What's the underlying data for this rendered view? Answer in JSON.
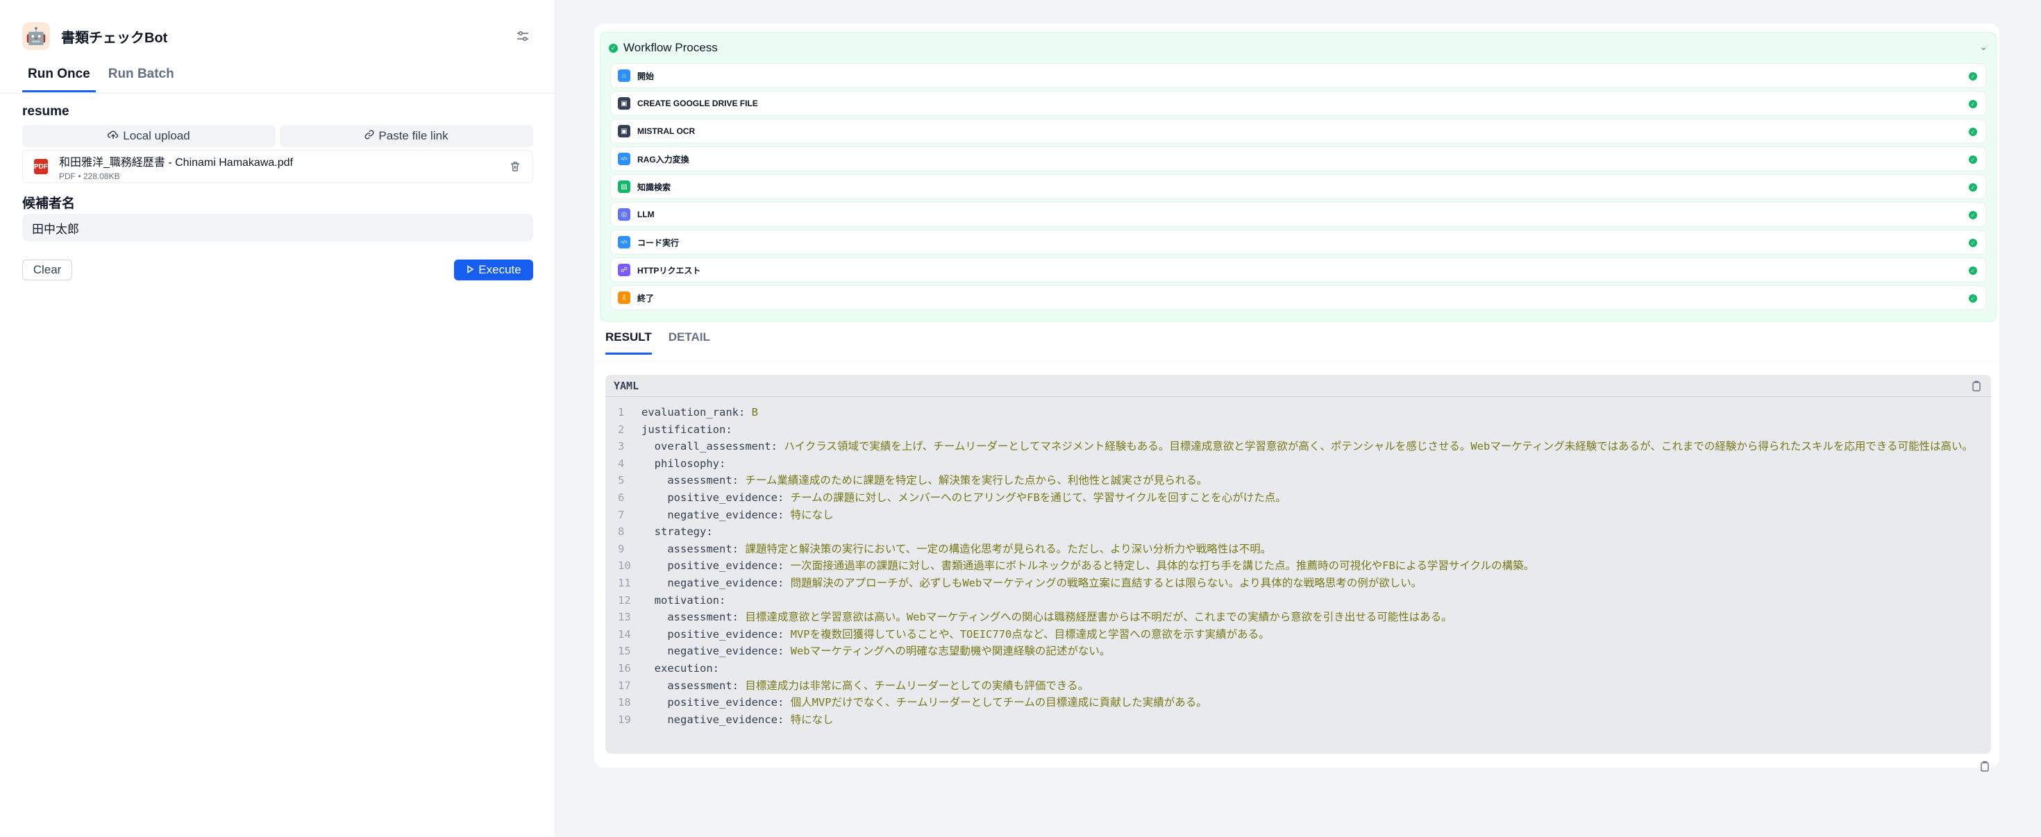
{
  "app": {
    "title": "書類チェックBot",
    "tabs": [
      "Run Once",
      "Run Batch"
    ]
  },
  "form": {
    "resume_label": "resume",
    "local_upload": "Local upload",
    "paste_link": "Paste file link",
    "file": {
      "name": "和田雅洋_職務経歴書 - Chinami Hamakawa.pdf",
      "meta": "PDF • 228.08KB",
      "type_badge": "PDF"
    },
    "candidate_label": "候補者名",
    "candidate_value": "田中太郎",
    "clear_label": "Clear",
    "execute_label": "Execute"
  },
  "workflow": {
    "title": "Workflow Process",
    "nodes": [
      {
        "label": "開始",
        "color": "#2e90fa"
      },
      {
        "label": "CREATE GOOGLE DRIVE FILE",
        "color": "#344054"
      },
      {
        "label": "MISTRAL OCR",
        "color": "#344054"
      },
      {
        "label": "RAG入力変換",
        "color": "#2e90fa"
      },
      {
        "label": "知識検索",
        "color": "#12b76a"
      },
      {
        "label": "LLM",
        "color": "#6172f3"
      },
      {
        "label": "コード実行",
        "color": "#2e90fa"
      },
      {
        "label": "HTTPリクエスト",
        "color": "#7a5af8"
      },
      {
        "label": "終了",
        "color": "#f79009"
      }
    ]
  },
  "result": {
    "tabs": [
      "RESULT",
      "DETAIL"
    ],
    "lang": "YAML",
    "lines": [
      {
        "n": "1",
        "indent": "",
        "key": "evaluation_rank:",
        "val": " B"
      },
      {
        "n": "2",
        "indent": "",
        "key": "justification:",
        "val": ""
      },
      {
        "n": "3",
        "indent": "  ",
        "key": "overall_assessment:",
        "val": " ハイクラス領域で実績を上げ、チームリーダーとしてマネジメント経験もある。目標達成意欲と学習意欲が高く、ポテンシャルを感じさせる。Webマーケティング未経験ではあるが、これまでの経験から得られたスキルを応用できる可能性は高い。"
      },
      {
        "n": "4",
        "indent": "  ",
        "key": "philosophy:",
        "val": ""
      },
      {
        "n": "5",
        "indent": "    ",
        "key": "assessment:",
        "val": " チーム業績達成のために課題を特定し、解決策を実行した点から、利他性と誠実さが見られる。"
      },
      {
        "n": "6",
        "indent": "    ",
        "key": "positive_evidence:",
        "val": " チームの課題に対し、メンバーへのヒアリングやFBを通じて、学習サイクルを回すことを心がけた点。"
      },
      {
        "n": "7",
        "indent": "    ",
        "key": "negative_evidence:",
        "val": " 特になし"
      },
      {
        "n": "8",
        "indent": "  ",
        "key": "strategy:",
        "val": ""
      },
      {
        "n": "9",
        "indent": "    ",
        "key": "assessment:",
        "val": " 課題特定と解決策の実行において、一定の構造化思考が見られる。ただし、より深い分析力や戦略性は不明。"
      },
      {
        "n": "10",
        "indent": "    ",
        "key": "positive_evidence:",
        "val": " 一次面接通過率の課題に対し、書類通過率にボトルネックがあると特定し、具体的な打ち手を講じた点。推薦時の可視化やFBによる学習サイクルの構築。"
      },
      {
        "n": "11",
        "indent": "    ",
        "key": "negative_evidence:",
        "val": " 問題解決のアプローチが、必ずしもWebマーケティングの戦略立案に直結するとは限らない。より具体的な戦略思考の例が欲しい。"
      },
      {
        "n": "12",
        "indent": "  ",
        "key": "motivation:",
        "val": ""
      },
      {
        "n": "13",
        "indent": "    ",
        "key": "assessment:",
        "val": " 目標達成意欲と学習意欲は高い。Webマーケティングへの関心は職務経歴書からは不明だが、これまでの実績から意欲を引き出せる可能性はある。"
      },
      {
        "n": "14",
        "indent": "    ",
        "key": "positive_evidence:",
        "val": " MVPを複数回獲得していることや、TOEIC770点など、目標達成と学習への意欲を示す実績がある。"
      },
      {
        "n": "15",
        "indent": "    ",
        "key": "negative_evidence:",
        "val": " Webマーケティングへの明確な志望動機や関連経験の記述がない。"
      },
      {
        "n": "16",
        "indent": "  ",
        "key": "execution:",
        "val": ""
      },
      {
        "n": "17",
        "indent": "    ",
        "key": "assessment:",
        "val": " 目標達成力は非常に高く、チームリーダーとしての実績も評価できる。"
      },
      {
        "n": "18",
        "indent": "    ",
        "key": "positive_evidence:",
        "val": " 個人MVPだけでなく、チームリーダーとしてチームの目標達成に貢献した実績がある。"
      },
      {
        "n": "19",
        "indent": "    ",
        "key": "negative_evidence:",
        "val": " 特になし"
      }
    ]
  }
}
